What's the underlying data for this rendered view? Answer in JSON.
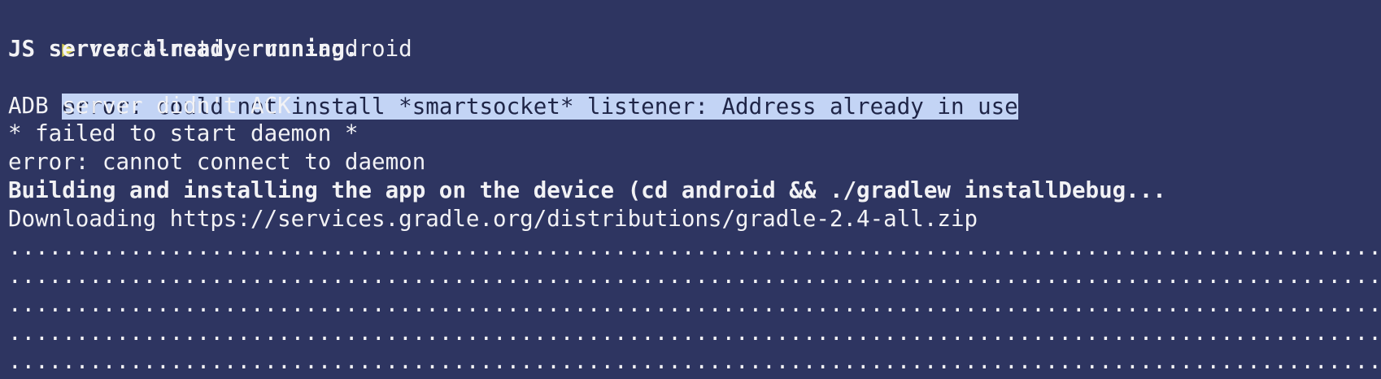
{
  "terminal": {
    "colors": {
      "background": "#2e3561",
      "foreground": "#f2f2f5",
      "prompt_arrow": "#d8cf52",
      "selection": "#c3d4f5"
    },
    "prompt_symbol": "▶",
    "command": " react-native run-android",
    "lines": [
      "JS server already running.",
      "error: could not install *smartsocket* listener: Address already in use",
      "ADB server didn't ACK",
      "* failed to start daemon *",
      "error: cannot connect to daemon",
      "Building and installing the app on the device (cd android && ./gradlew installDebug...",
      "Downloading https://services.gradle.org/distributions/gradle-2.4-all.zip",
      "...........................................................................................................",
      "...........................................................................................................",
      "...........................................................................................................",
      "...........................................................................................................",
      "..........................................................................................................."
    ]
  }
}
